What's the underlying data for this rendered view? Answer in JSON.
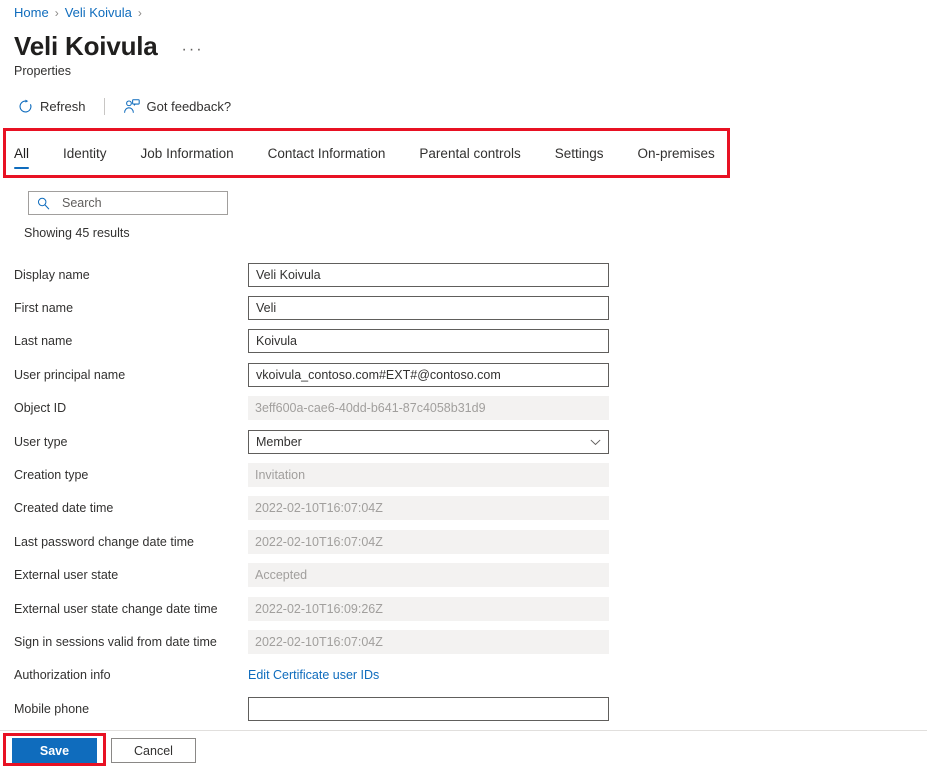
{
  "breadcrumb": {
    "items": [
      {
        "label": "Home",
        "icon": ""
      },
      {
        "label": "Veli Koivula",
        "icon": ""
      }
    ],
    "separator": "›",
    "link_color": "#0f6cbd"
  },
  "header": {
    "title": "Veli Koivula",
    "subtitle": "Properties",
    "more_menu": "···",
    "more_menu_name": "more-options-icon"
  },
  "commandbar": {
    "refresh": {
      "label": "Refresh",
      "icon": "refresh-icon"
    },
    "feedback": {
      "label": "Got feedback?",
      "icon": "feedback-person-icon"
    }
  },
  "tabs": {
    "items": [
      {
        "label": "All",
        "active": true
      },
      {
        "label": "Identity",
        "active": false
      },
      {
        "label": "Job Information",
        "active": false
      },
      {
        "label": "Contact Information",
        "active": false
      },
      {
        "label": "Parental controls",
        "active": false
      },
      {
        "label": "Settings",
        "active": false
      },
      {
        "label": "On-premises",
        "active": false
      }
    ],
    "active_indicator_color": "#0f6cbd"
  },
  "annotations": {
    "highlight_color": "#e81123",
    "boxes": [
      "tab-strip",
      "save-button"
    ]
  },
  "search": {
    "placeholder": "Search",
    "value": "",
    "icon": "search-icon"
  },
  "results": {
    "text": "Showing 45 results",
    "count": 45
  },
  "form": {
    "fields": [
      {
        "label": "Display name",
        "value": "Veli Koivula",
        "type": "text",
        "readonly": false,
        "name": "display-name"
      },
      {
        "label": "First name",
        "value": "Veli",
        "type": "text",
        "readonly": false,
        "name": "first-name"
      },
      {
        "label": "Last name",
        "value": "Koivula",
        "type": "text",
        "readonly": false,
        "name": "last-name"
      },
      {
        "label": "User principal name",
        "value": "vkoivula_contoso.com#EXT#@contoso.com",
        "type": "text",
        "readonly": false,
        "name": "user-principal-name"
      },
      {
        "label": "Object ID",
        "value": "3eff600a-cae6-40dd-b641-87c4058b31d9",
        "type": "readonly",
        "readonly": true,
        "name": "object-id"
      },
      {
        "label": "User type",
        "value": "Member",
        "type": "select",
        "readonly": false,
        "name": "user-type"
      },
      {
        "label": "Creation type",
        "value": "Invitation",
        "type": "readonly",
        "readonly": true,
        "name": "creation-type"
      },
      {
        "label": "Created date time",
        "value": "2022-02-10T16:07:04Z",
        "type": "readonly",
        "readonly": true,
        "name": "created-date-time"
      },
      {
        "label": "Last password change date time",
        "value": "2022-02-10T16:07:04Z",
        "type": "readonly",
        "readonly": true,
        "name": "last-password-change-date-time"
      },
      {
        "label": "External user state",
        "value": "Accepted",
        "type": "readonly",
        "readonly": true,
        "name": "external-user-state"
      },
      {
        "label": "External user state change date time",
        "value": "2022-02-10T16:09:26Z",
        "type": "readonly",
        "readonly": true,
        "name": "external-user-state-change-date-time"
      },
      {
        "label": "Sign in sessions valid from date time",
        "value": "2022-02-10T16:07:04Z",
        "type": "readonly",
        "readonly": true,
        "name": "sign-in-sessions-valid-from-date-time"
      },
      {
        "label": "Authorization info",
        "value": "Edit Certificate user IDs",
        "type": "link",
        "readonly": false,
        "name": "authorization-info"
      },
      {
        "label": "Mobile phone",
        "value": "",
        "type": "text",
        "readonly": false,
        "name": "mobile-phone"
      }
    ]
  },
  "footer": {
    "save_label": "Save",
    "cancel_label": "Cancel",
    "save_color": "#0f6cbd"
  }
}
